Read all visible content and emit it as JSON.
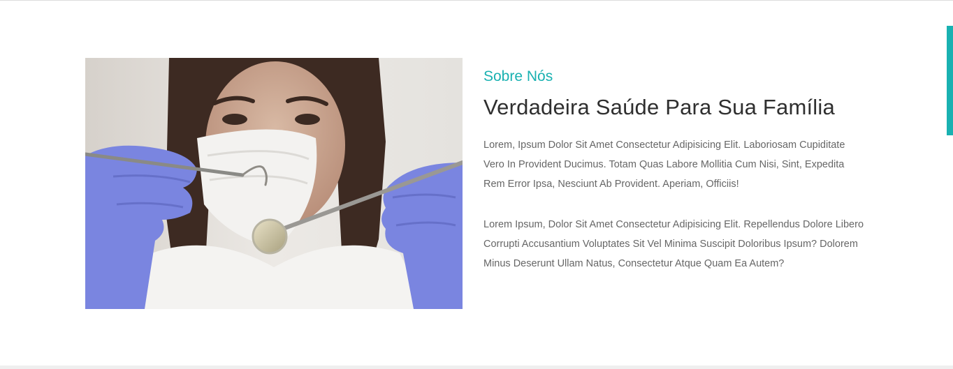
{
  "about": {
    "eyebrow": "Sobre Nós",
    "headline": "Verdadeira Saúde Para Sua Família",
    "paragraphs": [
      "Lorem, Ipsum Dolor Sit Amet Consectetur Adipisicing Elit. Laboriosam Cupiditate Vero In Provident Ducimus. Totam Quas Labore Mollitia Cum Nisi, Sint, Expedita Rem Error Ipsa, Nesciunt Ab Provident. Aperiam, Officiis!",
      "Lorem Ipsum, Dolor Sit Amet Consectetur Adipisicing Elit. Repellendus Dolore Libero Corrupti Accusantium Voluptates Sit Vel Minima Suscipit Doloribus Ipsum? Dolorem Minus Deserunt Ullam Natus, Consectetur Atque Quam Ea Autem?"
    ]
  },
  "photo": {
    "subject": "dentist-holding-dental-tools"
  },
  "colors": {
    "accent": "#19b1b1",
    "heading": "#2f2f2f",
    "body_text": "#666666",
    "glove": "#7a85e0"
  }
}
